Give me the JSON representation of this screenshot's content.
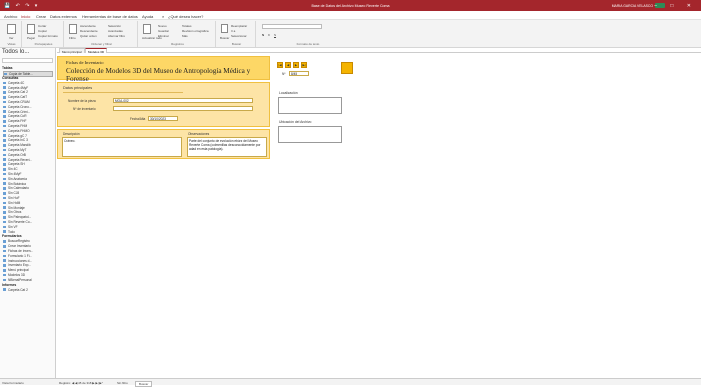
{
  "window": {
    "title": "Base de Datos del Archivo Museo Reverte Coma",
    "user": "MARIA GARCIA VELASCO",
    "quick_access": "💾 ↶ ↷ ▾",
    "controls": "– □ ✕"
  },
  "menu": {
    "items": [
      "Archivo",
      "Inicio",
      "Crear",
      "Datos externos",
      "Herramientas de base de datos",
      "Ayuda",
      "¿Qué desea hacer?"
    ],
    "active_index": 1
  },
  "ribbon": {
    "groups": [
      {
        "label": "Vistas",
        "buttons": [
          "Ver"
        ]
      },
      {
        "label": "Portapapeles",
        "buttons": [
          "Cortar",
          "Copiar",
          "Copiar formato",
          "Pegar"
        ]
      },
      {
        "label": "Ordenar y filtrar",
        "buttons": [
          "Filtro",
          "Ascendente",
          "Descendente",
          "Quitar orden",
          "Selección",
          "Avanzadas",
          "Alternar filtro"
        ]
      },
      {
        "label": "Registros",
        "buttons": [
          "Actualizar todo",
          "Nuevo",
          "Guardar",
          "Eliminar",
          "Totales",
          "Revisión ortográfica",
          "Más"
        ]
      },
      {
        "label": "Buscar",
        "buttons": [
          "Buscar",
          "Reemplazar",
          "Ir a",
          "Seleccionar"
        ]
      },
      {
        "label": "Formato de texto",
        "buttons": [
          "N",
          "K",
          "S"
        ]
      }
    ],
    "search_placeholder": "¿Qué desea hacer?"
  },
  "nav": {
    "header": "Todos lo...",
    "search_placeholder": "Buscar...",
    "categories": [
      {
        "name": "Tablas",
        "items": [
          "Copia de Table..."
        ]
      },
      {
        "name": "Consultas",
        "items": [
          "Carpeta 4C",
          "Carpeta 4MyF",
          "Carpeta Cat 2",
          "Carpeta CatT",
          "Carpeta CRAM",
          "Carpeta Crono...",
          "Carpeta Crimi...",
          "Carpeta CoR",
          "Carpeta FHF",
          "Carpeta FHM",
          "Carpeta FHMO",
          "Carpeta gC 7",
          "Carpeta InC 3",
          "Carpeta Mandib",
          "Carpeta MyT",
          "Carpeta OrB",
          "Carpeta Reveri...",
          "Carpeta SH",
          "Sin 4C",
          "Sin 4MyF",
          "Sin Anatomía",
          "Sin Botánica",
          "Sin Calendario",
          "Sin CJ8",
          "Sin HuF",
          "Sin HdM",
          "Sin Montaje",
          "Sin Otros",
          "Sin Paleopatol...",
          "Sin Reverte Co...",
          "Sin VF",
          "Todo"
        ]
      },
      {
        "name": "Formularios",
        "items": [
          "BuscarRegistro",
          "Crear Inventario",
          "Fichas de Inven...",
          "Formulario 1 Fi...",
          "Instrucciones d...",
          "Inventario Exp...",
          "Menú principal",
          "Modelos 3D",
          "NBienalPersonal"
        ]
      },
      {
        "name": "Informes",
        "items": [
          "Carpeta Cat 2"
        ]
      }
    ],
    "selected_item": "Copia de Table..."
  },
  "tabs": [
    {
      "label": "Menú principal",
      "active": false
    },
    {
      "label": "Modelos 3D",
      "active": true
    }
  ],
  "form": {
    "header_small": "Fichas de Inventario",
    "header_big": "Colección de Modelos 3D del Museo de Antropología Médica y Forense",
    "datos_title": "Datos principales",
    "fields": [
      {
        "label": "Nombre de la pieza",
        "value": "MOA-002"
      },
      {
        "label": "Nº de inventario",
        "value": ""
      },
      {
        "label": "Fecha/Alta",
        "value": "30/10/2023"
      }
    ],
    "descripcion_label": "Descripción",
    "descripcion_value": "Cráneo.",
    "observaciones_label": "Observaciones",
    "observaciones_value": "Parte del conjunto de evolución ebúrz del Museo Reverte Coma (colmenillas desconocidamente por adad en esta patología).",
    "nav_counter_label": "Nº",
    "nav_counter_value": "8/45",
    "nav_buttons": [
      "|◀",
      "◀",
      "▶",
      "▶|"
    ],
    "localizacion_label": "Localización",
    "ubicacion_label": "Ubicación del Archivo"
  },
  "status": {
    "record_label": "Registro: ◀ ◀ 45 de 318 ▶ ▶| ▶*",
    "filter_label": "Sin filtro",
    "search_label": "Buscar",
    "left_label": "Vista Formulario"
  }
}
